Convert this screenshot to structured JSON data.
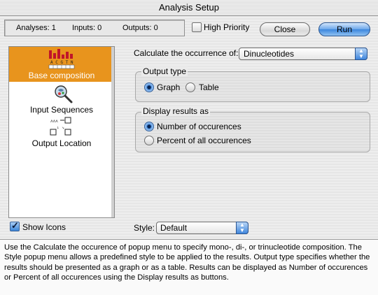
{
  "window": {
    "title": "Analysis Setup"
  },
  "status": {
    "analyses": "Analyses: 1",
    "inputs": "Inputs: 0",
    "outputs": "Outputs: 0"
  },
  "high_priority": {
    "label": "High Priority",
    "checked": false
  },
  "buttons": {
    "close": "Close",
    "run": "Run"
  },
  "sidebar": {
    "items": [
      {
        "label": "Base composition",
        "icon": "base-composition-icon",
        "selected": true
      },
      {
        "label": "Input Sequences",
        "icon": "input-sequences-icon",
        "selected": false
      },
      {
        "label": "Output Location",
        "icon": "output-location-icon",
        "selected": false
      }
    ]
  },
  "show_icons": {
    "label": "Show Icons",
    "checked": true
  },
  "calculate": {
    "label": "Calculate the occurrence of:",
    "value": "Dinucleotides"
  },
  "output_type": {
    "title": "Output type",
    "options": [
      "Graph",
      "Table"
    ],
    "selected": "Graph"
  },
  "display_results": {
    "title": "Display results as",
    "options": [
      "Number of occurences",
      "Percent of all occurences"
    ],
    "selected": "Number of occurences"
  },
  "style": {
    "label": "Style:",
    "value": "Default"
  },
  "help_text": "Use the Calculate the occurence of popup menu to specify mono-, di-, or trinucleotide composition. The Style popup menu allows a predefined style to be applied to the results. Output type specifies whether the results should be presented as a graph or as a table. Results can be displayed as Number of occurences or Percent of all occurences using the Display results as buttons.",
  "colors": {
    "selection": "#e8941d",
    "accent_blue": "#3b86dd"
  }
}
